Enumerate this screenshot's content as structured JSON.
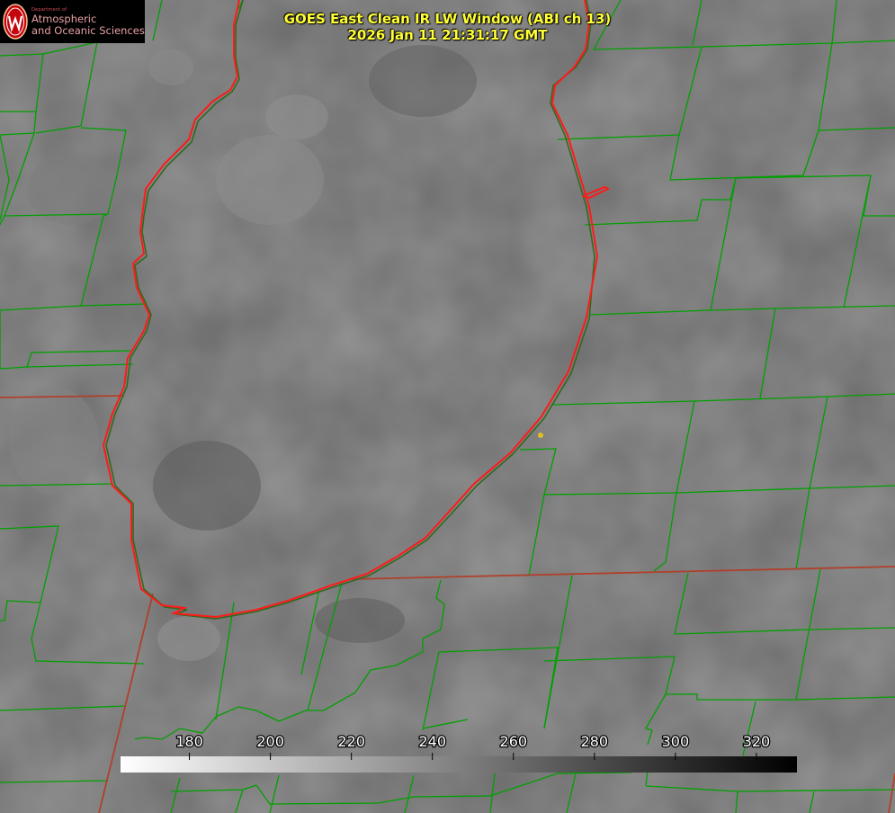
{
  "header": {
    "title_line1": "GOES East Clean IR LW Window (ABI ch 13)",
    "title_line2": "2026 Jan 11 21:31:17 GMT"
  },
  "logo": {
    "department": "Department of",
    "line1": "Atmospheric",
    "line2": "and Oceanic Sciences"
  },
  "colorbar": {
    "tick_labels": [
      "180",
      "200",
      "220",
      "240",
      "260",
      "280",
      "300",
      "320"
    ],
    "tick_values": [
      180,
      200,
      220,
      240,
      260,
      280,
      300,
      320
    ],
    "range": [
      163,
      330
    ],
    "gradient": "white-to-black"
  },
  "colors": {
    "county_lines": "#00a000",
    "state_lines": "#b0402a",
    "coastline": "#ff1a1a",
    "title_text": "#ffff33",
    "marker": "#e0c020"
  }
}
